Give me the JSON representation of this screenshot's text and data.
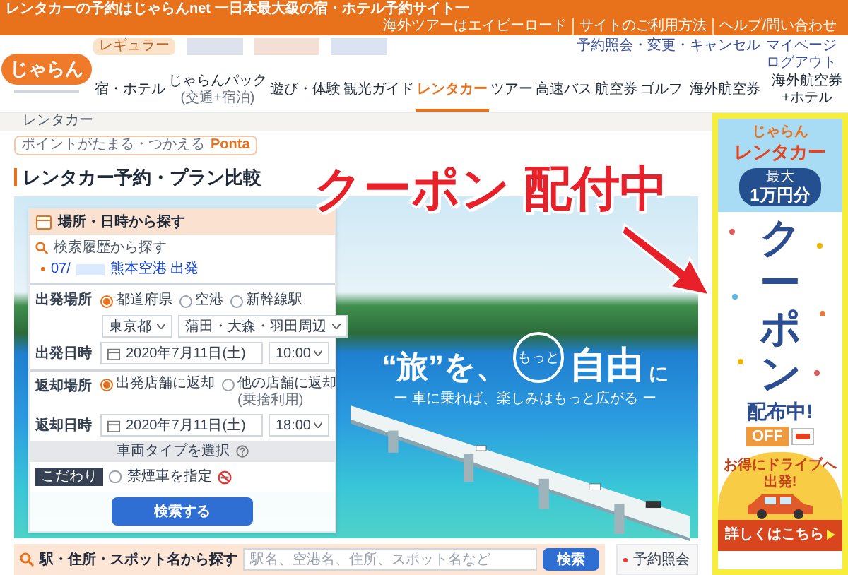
{
  "top_bar": {
    "tagline": "レンタカーの予約はじゃらんnet 一日本最大級の宿・ホテル予約サイト一",
    "links": [
      "海外ツアーはエイビーロード",
      "サイトのご利用方法",
      "ヘルプ/問い合わせ"
    ]
  },
  "header": {
    "logo": "じゃらん",
    "member_badge": "レギュラー",
    "account_links": [
      "予約照会・変更・キャンセル",
      "マイページ"
    ],
    "logout": "ログアウト"
  },
  "nav": [
    {
      "label": "宿・ホテル",
      "selected": false
    },
    {
      "label": "じゃらんパック",
      "sublabel": "(交通+宿泊)",
      "selected": false
    },
    {
      "label": "遊び・体験",
      "selected": false
    },
    {
      "label": "観光ガイド",
      "selected": false
    },
    {
      "label": "レンタカー",
      "selected": true
    },
    {
      "label": "ツアー",
      "selected": false
    },
    {
      "label": "高速バス",
      "selected": false
    },
    {
      "label": "航空券",
      "selected": false
    },
    {
      "label": "ゴルフ",
      "selected": false
    },
    {
      "label": "海外航空券",
      "selected": false
    },
    {
      "label": "海外航空券+ホテル",
      "selected": false
    }
  ],
  "breadcrumb": "レンタカー",
  "points_banner": {
    "text": "ポイントがたまる・つかえる",
    "brand": "Ponta"
  },
  "page_title": "レンタカー予約・プラン比較",
  "annotation": "クーポン 配付中",
  "search_form": {
    "title": "場所・日時から探す",
    "history_link": "検索履歴から探す",
    "history": [
      {
        "date": "07/",
        "place": "熊本空港 出発"
      }
    ],
    "departure_place": {
      "label": "出発場所",
      "options": [
        {
          "label": "都道府県",
          "selected": true
        },
        {
          "label": "空港",
          "selected": false
        },
        {
          "label": "新幹線駅",
          "selected": false
        }
      ],
      "prefecture": "東京都",
      "area": "蒲田・大森・羽田周辺"
    },
    "departure_time": {
      "label": "出発日時",
      "date": "2020年7月11日(土)",
      "time": "10:00"
    },
    "return_place": {
      "label": "返却場所",
      "options": [
        {
          "label": "出発店舗に返却",
          "selected": true
        },
        {
          "label": "他の店舗に返却",
          "note": "(乗捨利用)",
          "selected": false
        }
      ]
    },
    "return_time": {
      "label": "返却日時",
      "date": "2020年7月11日(土)",
      "time": "18:00"
    },
    "vehicle_type": "車両タイプを選択",
    "preference_tag": "こだわり",
    "non_smoking": {
      "label": "禁煙車を指定",
      "checked": false
    },
    "submit": "検索する"
  },
  "hero": {
    "lead": "“旅”を、",
    "circled": "もっと",
    "main": "自由",
    "tail": "に",
    "subtitle": "ー 車に乗れば、楽しみはもっと広がる ー"
  },
  "keyword_search": {
    "title": "駅・住所・スポット名から探す",
    "placeholder": "駅名、空港名、住所、スポット名など",
    "button": "検索"
  },
  "side_box": {
    "link": "予約照会"
  },
  "ad": {
    "brand_top": "じゃらん",
    "brand": "レンタカー",
    "badge_top": "最大",
    "badge_amount": "1万円分",
    "headline": "クーポン",
    "subline": "配布中!",
    "tag": "OFF",
    "tagline": "お得にドライブへ出発!",
    "cta": "詳しくはこちら"
  }
}
